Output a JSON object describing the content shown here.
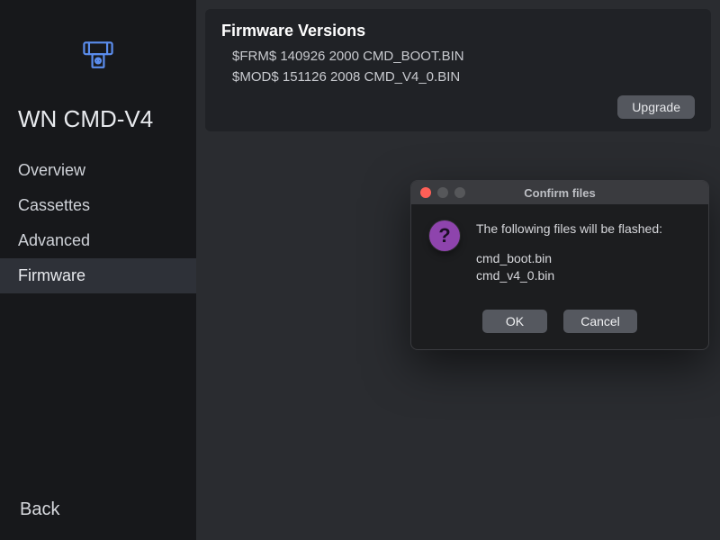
{
  "sidebar": {
    "device_title": "WN CMD-V4",
    "items": [
      {
        "label": "Overview"
      },
      {
        "label": "Cassettes"
      },
      {
        "label": "Advanced"
      },
      {
        "label": "Firmware"
      }
    ],
    "back_label": "Back"
  },
  "firmware_card": {
    "title": "Firmware Versions",
    "lines": [
      "$FRM$ 140926 2000 CMD_BOOT.BIN",
      "$MOD$ 151126 2008 CMD_V4_0.BIN"
    ],
    "upgrade_label": "Upgrade"
  },
  "modal": {
    "title": "Confirm files",
    "lead": "The following files will be flashed:",
    "files": [
      "cmd_boot.bin",
      "cmd_v4_0.bin"
    ],
    "ok_label": "OK",
    "cancel_label": "Cancel"
  },
  "colors": {
    "accent_icon": "#5b8dee",
    "question_bg": "#8e44ad"
  }
}
